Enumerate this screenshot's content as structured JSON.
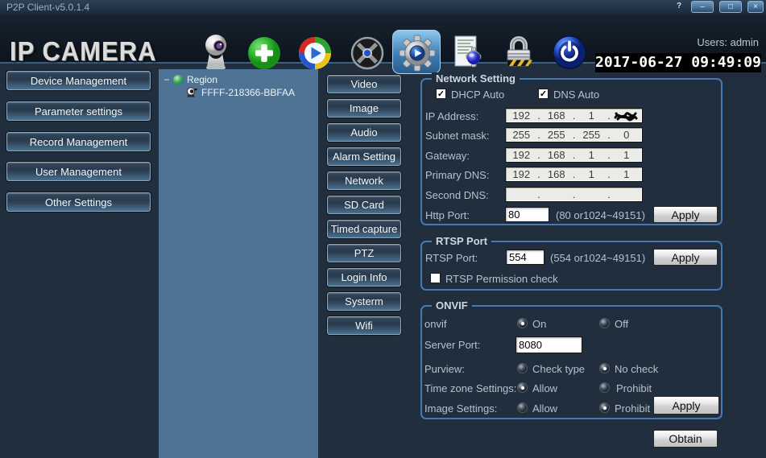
{
  "window": {
    "title": "P2P Client-v5.0.1.4",
    "help_glyph": "?",
    "minimize_glyph": "–",
    "maximize_glyph": "□",
    "close_glyph": "×"
  },
  "header": {
    "logo": "IP CAMERA",
    "users_label": "Users: admin",
    "clock": "2017-06-27 09:49:09",
    "toolbar_icons": [
      "webcam-monitor",
      "add-device",
      "media-player",
      "record-reel",
      "settings-gear",
      "system-log",
      "lock-security",
      "power-exit"
    ],
    "active_tool": "settings-gear"
  },
  "sidebar": {
    "items": [
      {
        "label": "Device Management"
      },
      {
        "label": "Parameter settings"
      },
      {
        "label": "Record Management"
      },
      {
        "label": "User Management"
      },
      {
        "label": "Other Settings"
      }
    ]
  },
  "tree": {
    "collapse_glyph": "−",
    "root_label": "Region",
    "device_label": "FFFF-218366-BBFAA"
  },
  "tabs": {
    "active": "Network",
    "items": [
      {
        "label": "Video"
      },
      {
        "label": "Image"
      },
      {
        "label": "Audio"
      },
      {
        "label": "Alarm Setting"
      },
      {
        "label": "Network"
      },
      {
        "label": "SD Card"
      },
      {
        "label": "Timed capture"
      },
      {
        "label": "PTZ"
      },
      {
        "label": "Login Info"
      },
      {
        "label": "Systerm"
      },
      {
        "label": "Wifi"
      }
    ]
  },
  "network": {
    "legend": "Network Setting",
    "dhcp_auto": {
      "label": "DHCP Auto",
      "checked": true
    },
    "dns_auto": {
      "label": "DNS Auto",
      "checked": true
    },
    "rows": [
      {
        "label": "IP Address:",
        "o": [
          "192",
          "168",
          "1",
          ""
        ],
        "censored_last_octet": true
      },
      {
        "label": "Subnet mask:",
        "o": [
          "255",
          "255",
          "255",
          "0"
        ]
      },
      {
        "label": "Gateway:",
        "o": [
          "192",
          "168",
          "1",
          "1"
        ]
      },
      {
        "label": "Primary DNS:",
        "o": [
          "192",
          "168",
          "1",
          "1"
        ]
      },
      {
        "label": "Second DNS:",
        "o": [
          "",
          "",
          "",
          ""
        ]
      }
    ],
    "http_port": {
      "label": "Http Port:",
      "value": "80",
      "hint": "(80 or1024~49151)"
    },
    "apply_label": "Apply"
  },
  "rtsp": {
    "legend": "RTSP Port",
    "port": {
      "label": "RTSP Port:",
      "value": "554",
      "hint": "(554 or1024~49151)"
    },
    "apply_label": "Apply",
    "permission": {
      "label": "RTSP Permission check",
      "checked": false
    }
  },
  "onvif": {
    "legend": "ONVIF",
    "onvif_row": {
      "label": "onvif",
      "on": "On",
      "off": "Off",
      "selected": "On"
    },
    "server_port": {
      "label": "Server Port:",
      "value": "8080"
    },
    "purview": {
      "label": "Purview:",
      "option1": "Check type",
      "option2": "No check",
      "selected": "No check"
    },
    "timezone": {
      "label": "Time zone Settings:",
      "option1": "Allow",
      "option2": "Prohibit",
      "selected": "Allow"
    },
    "image": {
      "label": "Image Settings:",
      "option1": "Allow",
      "option2": "Prohibit",
      "selected": "Prohibit"
    },
    "apply_label": "Apply"
  },
  "obtain_label": "Obtain",
  "colors": {
    "main_bg": "#202e3d",
    "tree_bg": "#4e7394",
    "group_border": "#4679b4",
    "tool_highlight": "#5aa7dd",
    "clock_bg": "#000000",
    "clock_fg": "#ffffff"
  }
}
